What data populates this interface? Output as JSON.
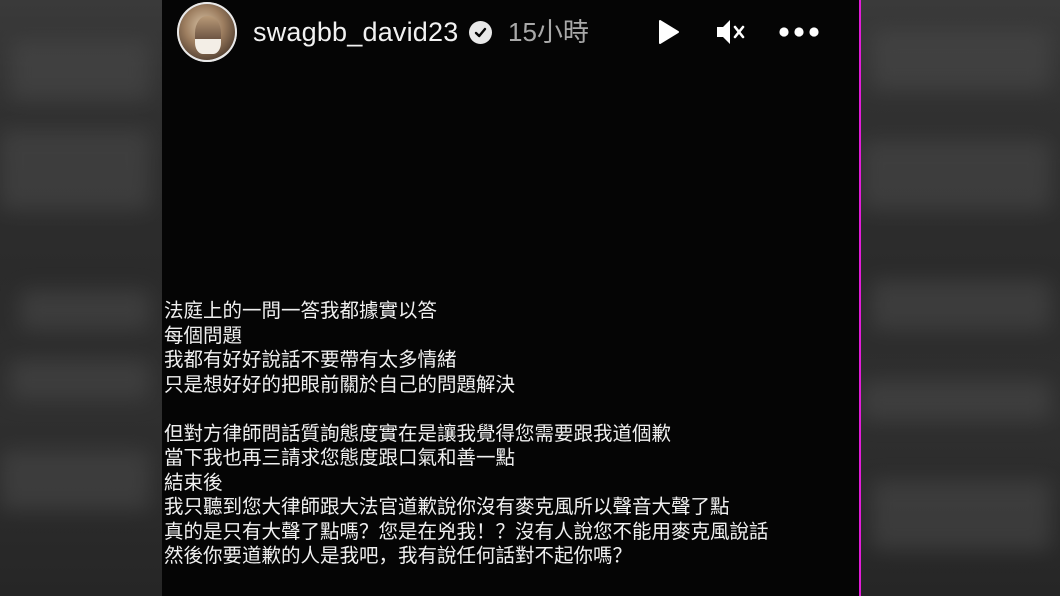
{
  "header": {
    "username": "swagbb_david23",
    "verified_icon": "verified-badge-icon",
    "time_ago": "15小時",
    "controls": {
      "play_icon": "play-icon",
      "mute_icon": "mute-icon",
      "more_icon": "more-options-icon"
    }
  },
  "post": {
    "paragraph1": [
      "法庭上的一問一答我都據實以答",
      "每個問題",
      "我都有好好說話不要帶有太多情緒",
      "只是想好好的把眼前關於自己的問題解決"
    ],
    "paragraph2": [
      "但對方律師問話質詢態度實在是讓我覺得您需要跟我道個歉",
      "當下我也再三請求您態度跟口氣和善一點",
      "結束後",
      "我只聽到您大律師跟大法官道歉說你沒有麥克風所以聲音大聲了點",
      "真的是只有大聲了點嗎？您是在兇我！？沒有人說您不能用麥克風說話",
      "然後你要道歉的人是我吧，我有說任何話對不起你嗎？"
    ]
  },
  "colors": {
    "story_background": "#050505",
    "text": "#f0f0f0",
    "time_text": "#a9a9a9",
    "edge_accent": "#e21cd8"
  }
}
